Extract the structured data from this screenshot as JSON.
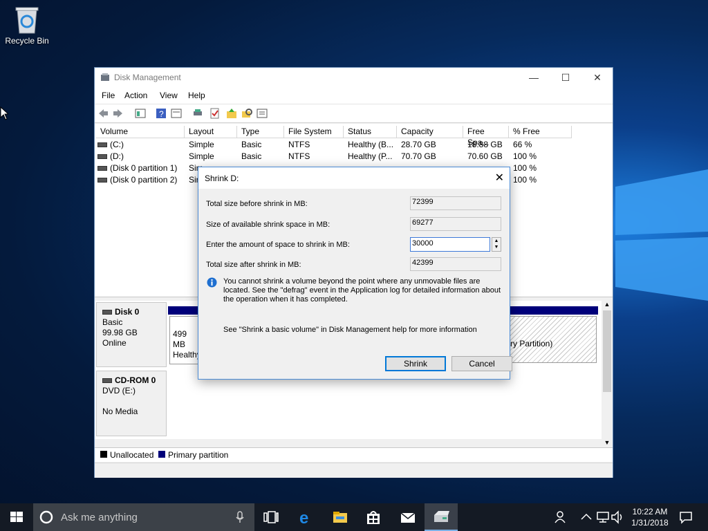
{
  "desktop": {
    "recycle_bin_label": "Recycle Bin"
  },
  "window": {
    "title": "Disk Management",
    "menu": [
      "File",
      "Action",
      "View",
      "Help"
    ],
    "columns": [
      "Volume",
      "Layout",
      "Type",
      "File System",
      "Status",
      "Capacity",
      "Free Spa...",
      "% Free"
    ],
    "rows": [
      {
        "volume": "(C:)",
        "layout": "Simple",
        "type": "Basic",
        "fs": "NTFS",
        "status": "Healthy (B...",
        "capacity": "28.70 GB",
        "free": "18.88 GB",
        "pct": "66 %"
      },
      {
        "volume": "(D:)",
        "layout": "Simple",
        "type": "Basic",
        "fs": "NTFS",
        "status": "Healthy (P...",
        "capacity": "70.70 GB",
        "free": "70.60 GB",
        "pct": "100 %"
      },
      {
        "volume": "(Disk 0 partition 1)",
        "layout": "Sim",
        "type": "",
        "fs": "",
        "status": "",
        "capacity": "",
        "free": "",
        "pct": "100 %"
      },
      {
        "volume": "(Disk 0 partition 2)",
        "layout": "Sir",
        "type": "",
        "fs": "",
        "status": "",
        "capacity": "",
        "free": "",
        "pct": "100 %"
      }
    ],
    "disk0": {
      "name": "Disk 0",
      "type": "Basic",
      "size": "99.98 GB",
      "state": "Online",
      "part1_line1": "499 MB",
      "part1_line2": "Healthy",
      "part3_text": "ry Partition)"
    },
    "cdrom": {
      "name": "CD-ROM 0",
      "device": "DVD (E:)",
      "media": "No Media"
    },
    "legend": {
      "unallocated": "Unallocated",
      "primary": "Primary partition"
    }
  },
  "dialog": {
    "title": "Shrink D:",
    "total_before_label": "Total size before shrink in MB:",
    "total_before_value": "72399",
    "available_label": "Size of available shrink space in MB:",
    "available_value": "69277",
    "amount_label": "Enter the amount of space to shrink in MB:",
    "amount_value": "30000",
    "total_after_label": "Total size after shrink in MB:",
    "total_after_value": "42399",
    "info_text": "You cannot shrink a volume beyond the point where any unmovable files are located. See the \"defrag\" event in the Application log for detailed information about the operation when it has completed.",
    "help_text": "See \"Shrink a basic volume\" in Disk Management help for more information",
    "shrink_button": "Shrink",
    "cancel_button": "Cancel"
  },
  "taskbar": {
    "search_placeholder": "Ask me anything",
    "time": "10:22 AM",
    "date": "1/31/2018"
  },
  "colors": {
    "primary_partition": "#00007a",
    "accent": "#0078d7",
    "taskbar": "#141a24"
  }
}
